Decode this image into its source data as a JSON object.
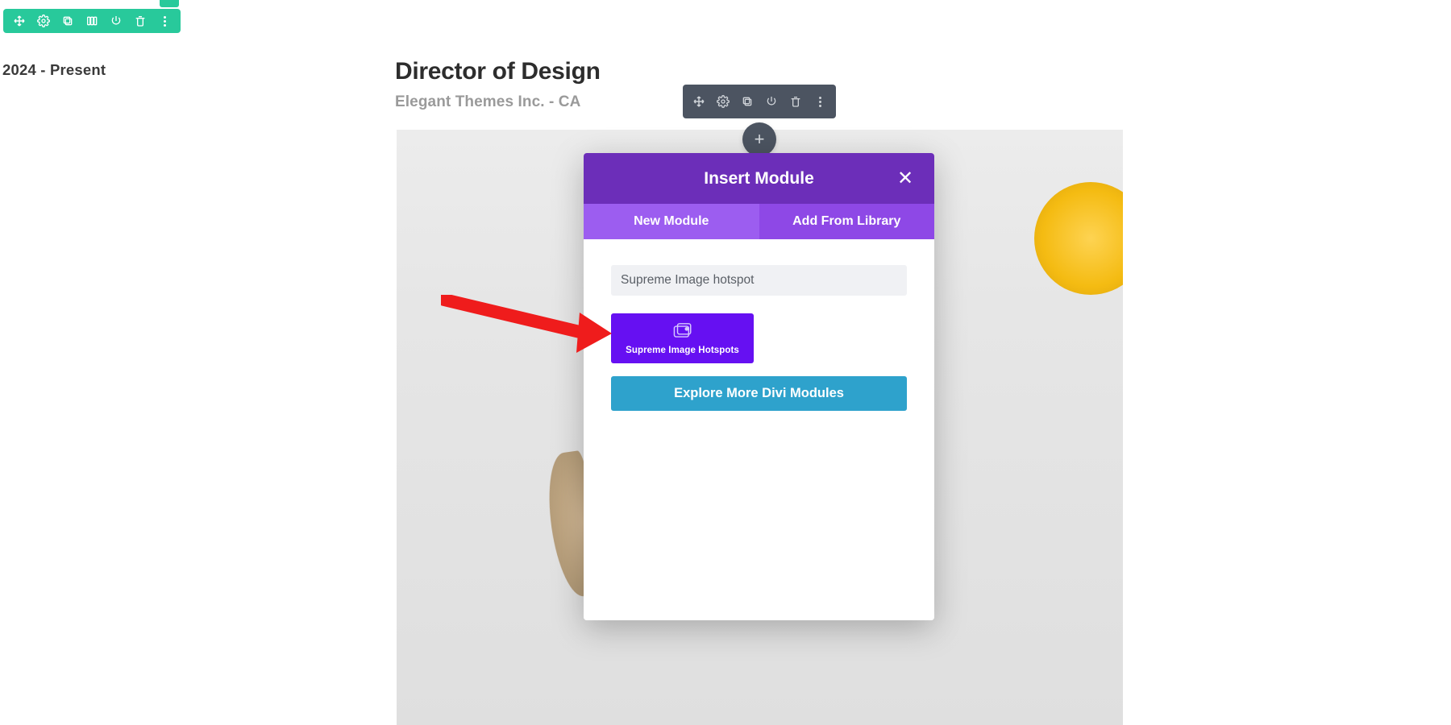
{
  "left": {
    "date_range": "2024 - Present"
  },
  "content": {
    "job_title": "Director of Design",
    "company_line": "Elegant Themes Inc. - CA"
  },
  "add_button_glyph": "+",
  "modal": {
    "title": "Insert Module",
    "close_glyph": "✕",
    "tabs": {
      "new": "New Module",
      "library": "Add From Library"
    },
    "search_value": "Supreme Image hotspot",
    "card_label": "Supreme Image Hotspots",
    "explore_label": "Explore More Divi Modules"
  },
  "icons": {
    "section_toolbar": [
      "move",
      "settings",
      "duplicate",
      "columns",
      "power",
      "delete",
      "more"
    ],
    "module_toolbar": [
      "move",
      "settings",
      "duplicate",
      "power",
      "delete",
      "more"
    ]
  }
}
